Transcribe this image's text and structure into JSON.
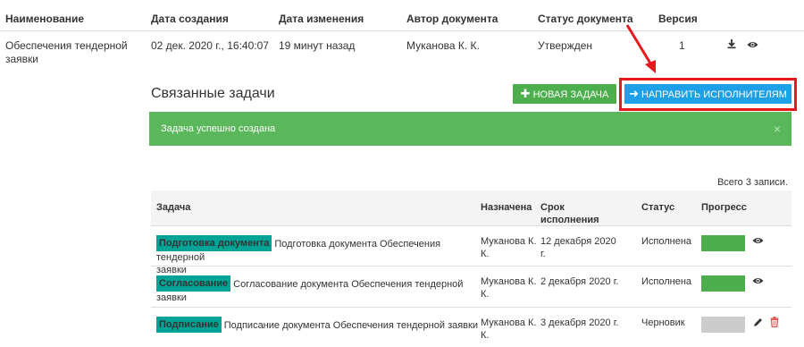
{
  "document_table": {
    "headers": {
      "name": "Наименование",
      "created": "Дата создания",
      "modified": "Дата изменения",
      "author": "Автор документа",
      "status": "Статус документа",
      "version": "Версия"
    },
    "row": {
      "name_line1": "Обеспечения тендерной",
      "name_line2": "заявки",
      "created": "02 дек. 2020 г., 16:40:07",
      "modified": "19 минут назад",
      "author": "Муканова К. К.",
      "status": "Утвержден",
      "version": "1"
    }
  },
  "related_tasks": {
    "title": "Связанные задачи",
    "new_task_button": "НОВАЯ ЗАДАЧА",
    "send_button": "НАПРАВИТЬ ИСПОЛНИТЕЛЯМ",
    "alert_message": "Задача успешно создана",
    "alert_close": "×",
    "total_records": "Всего 3 записи."
  },
  "tasks_table": {
    "headers": {
      "task": "Задача",
      "assigned": "Назначена",
      "deadline_line1": "Срок",
      "deadline_line2": "исполнения",
      "status": "Статус",
      "progress": "Прогресс"
    },
    "rows": [
      {
        "badge": "Подготовка документа",
        "title_line1": "Подготовка документа Обеспечения тендерной",
        "title_line2": "заявки",
        "assigned_line1": "Муканова К.",
        "assigned_line2": "К.",
        "deadline_line1": "12 декабря 2020",
        "deadline_line2": "г.",
        "status": "Исполнена",
        "progress": 1.0
      },
      {
        "badge": "Согласование",
        "title_line1": "Согласование документа Обеспечения тендерной заявки",
        "title_line2": "",
        "assigned_line1": "Муканова К.",
        "assigned_line2": "К.",
        "deadline_line1": "2 декабря 2020 г.",
        "deadline_line2": "",
        "status": "Исполнена",
        "progress": 1.0
      },
      {
        "badge": "Подписание",
        "title_line1": "Подписание документа Обеспечения тендерной заявки",
        "title_line2": "",
        "assigned_line1": "Муканова К.",
        "assigned_line2": "К.",
        "deadline_line1": "3 декабря 2020 г.",
        "deadline_line2": "",
        "status": "Черновик",
        "progress": 0.0
      }
    ]
  },
  "colors": {
    "success_green": "#5bb75b",
    "button_green": "#4cae4c",
    "button_blue": "#1ea0e8",
    "badge_teal": "#00a497",
    "highlight_red": "#e8191e",
    "progress_done": "#4cae4c",
    "progress_empty": "#cccccc",
    "delete_red": "#d9534f"
  },
  "icons": {
    "download": "download-icon",
    "view": "eye-icon",
    "edit": "pencil-icon",
    "delete": "trash-icon",
    "plus": "plus-icon",
    "arrow": "arrow-right-icon"
  }
}
